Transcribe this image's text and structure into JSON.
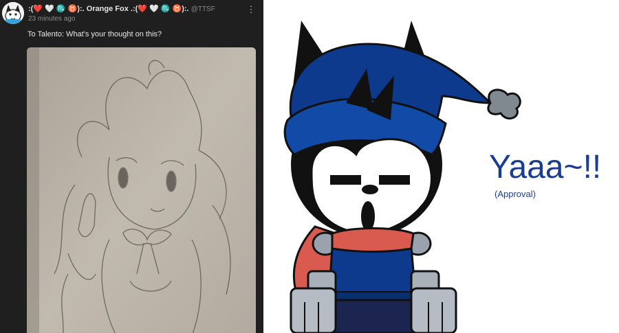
{
  "post": {
    "username": ":(❤️ 🤍 ♏ ♉):. Orange Fox .:(❤️ 🤍 ♏ ♉):.",
    "handle": "@TTSF",
    "timestamp": "23 minutes ago",
    "text": "To Talento: What's your thought on this?",
    "menu_icon": "kebab-menu-icon"
  },
  "reaction": {
    "exclamation": "Yaaa~!!",
    "caption": "(Approval)"
  },
  "colors": {
    "panel_bg": "#1f1f1f",
    "text_blue": "#1c3d8f",
    "hat_blue": "#0d3a8c",
    "scarf_red": "#d95a4e"
  }
}
